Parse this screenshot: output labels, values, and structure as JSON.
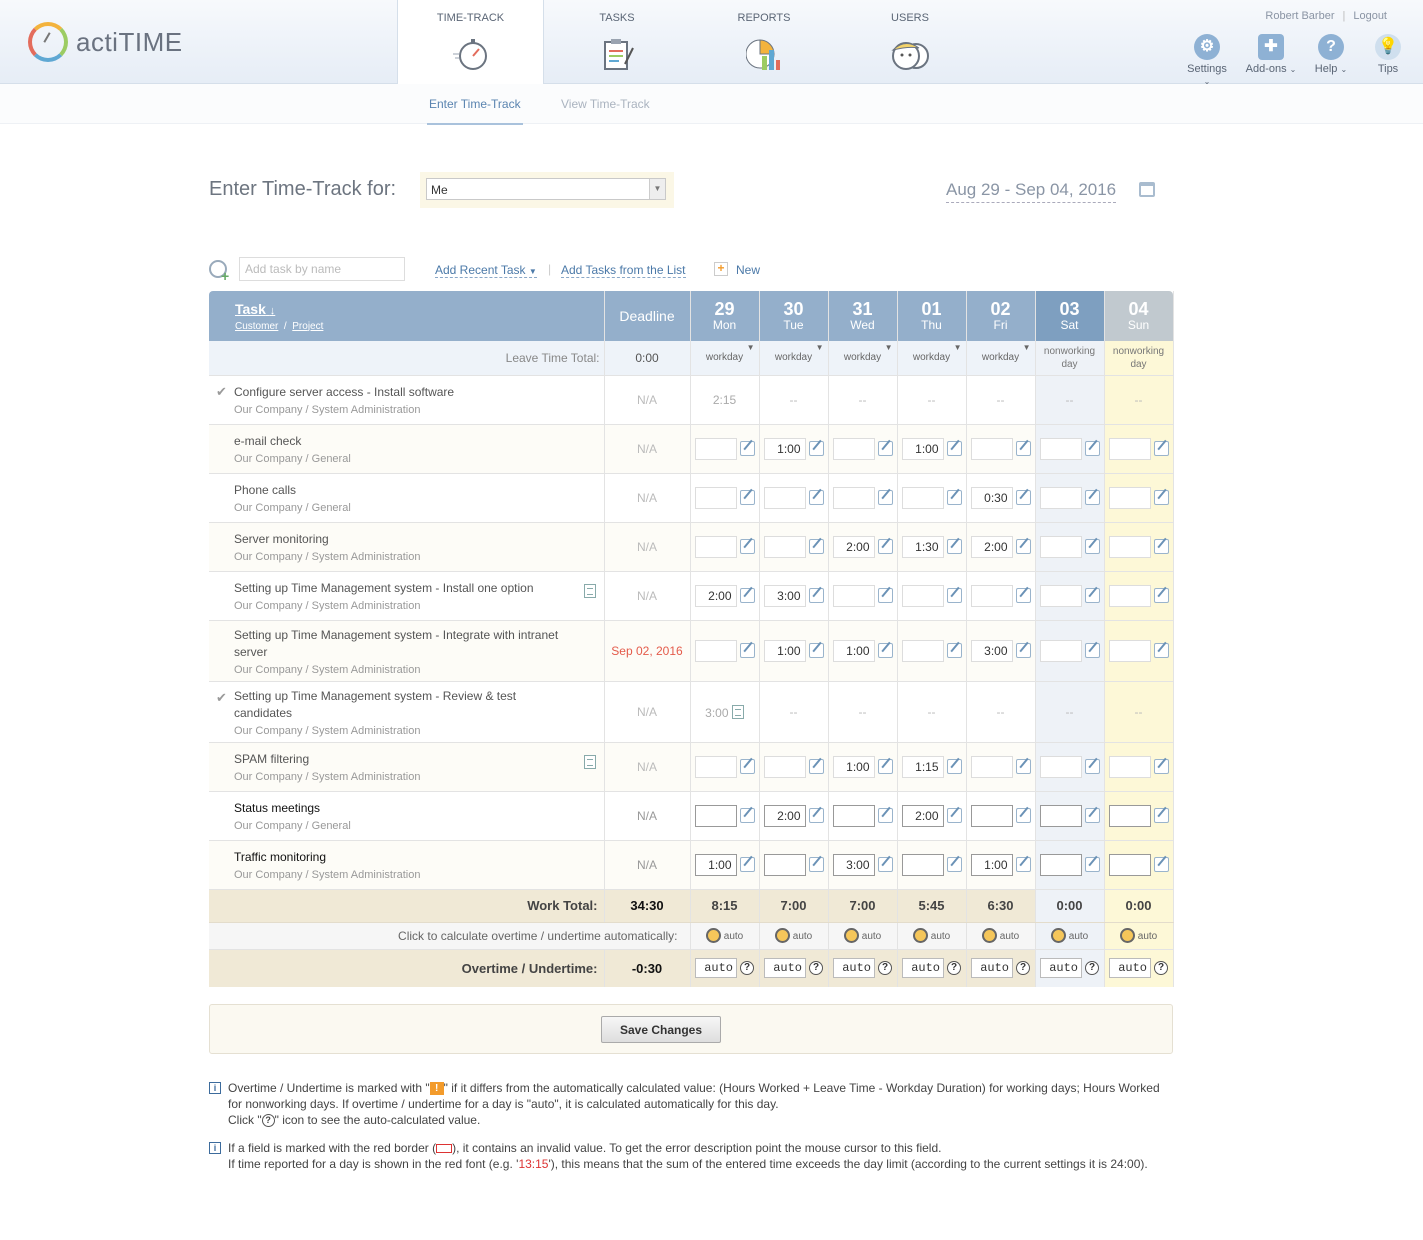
{
  "app": {
    "name": "actiTIME"
  },
  "nav": [
    {
      "label": "TIME-TRACK",
      "icon": "stopwatch-icon",
      "active": true
    },
    {
      "label": "TASKS",
      "icon": "clipboard-icon"
    },
    {
      "label": "REPORTS",
      "icon": "chart-icon"
    },
    {
      "label": "USERS",
      "icon": "users-icon"
    }
  ],
  "user": {
    "name": "Robert Barber",
    "logout": "Logout"
  },
  "tools": [
    {
      "label": "Settings",
      "icon": "gear-icon"
    },
    {
      "label": "Add-ons",
      "icon": "puzzle-icon"
    },
    {
      "label": "Help",
      "icon": "help-icon"
    },
    {
      "label": "Tips",
      "icon": "lightbulb-icon"
    }
  ],
  "subnav": [
    {
      "label": "Enter Time-Track",
      "active": true
    },
    {
      "label": "View Time-Track"
    }
  ],
  "heading": "Enter Time-Track for:",
  "user_select": {
    "value": "Me"
  },
  "date_range": "Aug 29 - Sep 04, 2016",
  "add_task": {
    "placeholder": "Add task by name",
    "recent": "Add Recent Task",
    "from_list": "Add Tasks from the List",
    "new": "New"
  },
  "table": {
    "task_header": "Task",
    "customer_label": "Customer",
    "project_label": "Project",
    "slash": "/",
    "deadline_header": "Deadline",
    "days": [
      {
        "num": "29",
        "dow": "Mon"
      },
      {
        "num": "30",
        "dow": "Tue"
      },
      {
        "num": "31",
        "dow": "Wed"
      },
      {
        "num": "01",
        "dow": "Thu"
      },
      {
        "num": "02",
        "dow": "Fri"
      },
      {
        "num": "03",
        "dow": "Sat"
      },
      {
        "num": "04",
        "dow": "Sun"
      }
    ],
    "leave_label": "Leave Time Total:",
    "leave_total": "0:00",
    "day_types": [
      "workday",
      "workday",
      "workday",
      "workday",
      "workday",
      "nonworking day",
      "nonworking day"
    ],
    "tasks": [
      {
        "name": "Configure server access - Install software",
        "cp": "Our Company  /  System Administration",
        "deadline": "N/A",
        "completed": true,
        "cells": [
          "2:15",
          "--",
          "--",
          "--",
          "--",
          "--",
          "--"
        ]
      },
      {
        "name": "e-mail check",
        "cp": "Our Company  /  General",
        "deadline": "N/A",
        "cells": [
          "",
          "1:00",
          "",
          "1:00",
          "",
          "",
          ""
        ]
      },
      {
        "name": "Phone calls",
        "cp": "Our Company  /  General",
        "deadline": "N/A",
        "cells": [
          "",
          "",
          "",
          "",
          "0:30",
          "",
          ""
        ]
      },
      {
        "name": "Server monitoring",
        "cp": "Our Company  /  System Administration",
        "deadline": "N/A",
        "cells": [
          "",
          "",
          "2:00",
          "1:30",
          "2:00",
          "",
          ""
        ]
      },
      {
        "name": "Setting up Time Management system - Install one option",
        "cp": "Our Company  /  System Administration",
        "deadline": "N/A",
        "note": true,
        "cells": [
          "2:00",
          "3:00",
          "",
          "",
          "",
          "",
          ""
        ]
      },
      {
        "name": "Setting up Time Management system - Integrate with intranet server",
        "cp": "Our Company  /  System Administration",
        "deadline": "Sep 02, 2016",
        "cells": [
          "",
          "1:00",
          "1:00",
          "",
          "3:00",
          "",
          ""
        ]
      },
      {
        "name": "Setting up Time Management system - Review & test candidates",
        "cp": "Our Company  /  System Administration",
        "deadline": "N/A",
        "completed": true,
        "cells": [
          "3:00",
          "--",
          "--",
          "--",
          "--",
          "--",
          "--"
        ]
      },
      {
        "name": "SPAM filtering",
        "cp": "Our Company  /  System Administration",
        "deadline": "N/A",
        "note": true,
        "cells": [
          "",
          "",
          "1:00",
          "1:15",
          "",
          "",
          ""
        ]
      },
      {
        "name": "Status meetings",
        "cp": "Our Company  /  General",
        "deadline": "N/A",
        "highlight": true,
        "cells": [
          "",
          "2:00",
          "",
          "2:00",
          "",
          "",
          ""
        ]
      },
      {
        "name": "Traffic monitoring",
        "cp": "Our Company  /  System Administration",
        "deadline": "N/A",
        "highlight": true,
        "cells": [
          "1:00",
          "",
          "3:00",
          "",
          "1:00",
          "",
          ""
        ]
      }
    ],
    "work_total_label": "Work Total:",
    "work_total": "34:30",
    "day_totals": [
      "8:15",
      "7:00",
      "7:00",
      "5:45",
      "6:30",
      "0:00",
      "0:00"
    ],
    "calc_label": "Click to calculate overtime / undertime automatically:",
    "auto": "auto",
    "overtime_label": "Overtime / Undertime:",
    "overtime_total": "-0:30",
    "help_mark": "?"
  },
  "save_label": "Save Changes",
  "info_mark": "i",
  "info": {
    "p1a": "Overtime / Undertime is marked with \"",
    "p1_mark": "!",
    "p1b": "\" if it differs from the automatically calculated value: (Hours Worked + Leave Time - Workday Duration) for working days; Hours Worked for nonworking days. If overtime / undertime for a day is \"auto\", it is calculated automatically for this day.",
    "p1c": "Click \"",
    "p1_help": "?",
    "p1d": "\" icon to see the auto-calculated value.",
    "p2a": "If a field is marked with the red border (",
    "p2b": "), it contains an invalid value. To get the error description point the mouse cursor to this field.",
    "p2c": "If time reported for a day is shown in the red font (e.g. '",
    "p2_example": "13:15",
    "p2d": "'), this means that the sum of the entered time exceeds the day limit (according to the current settings it is 24:00)."
  }
}
